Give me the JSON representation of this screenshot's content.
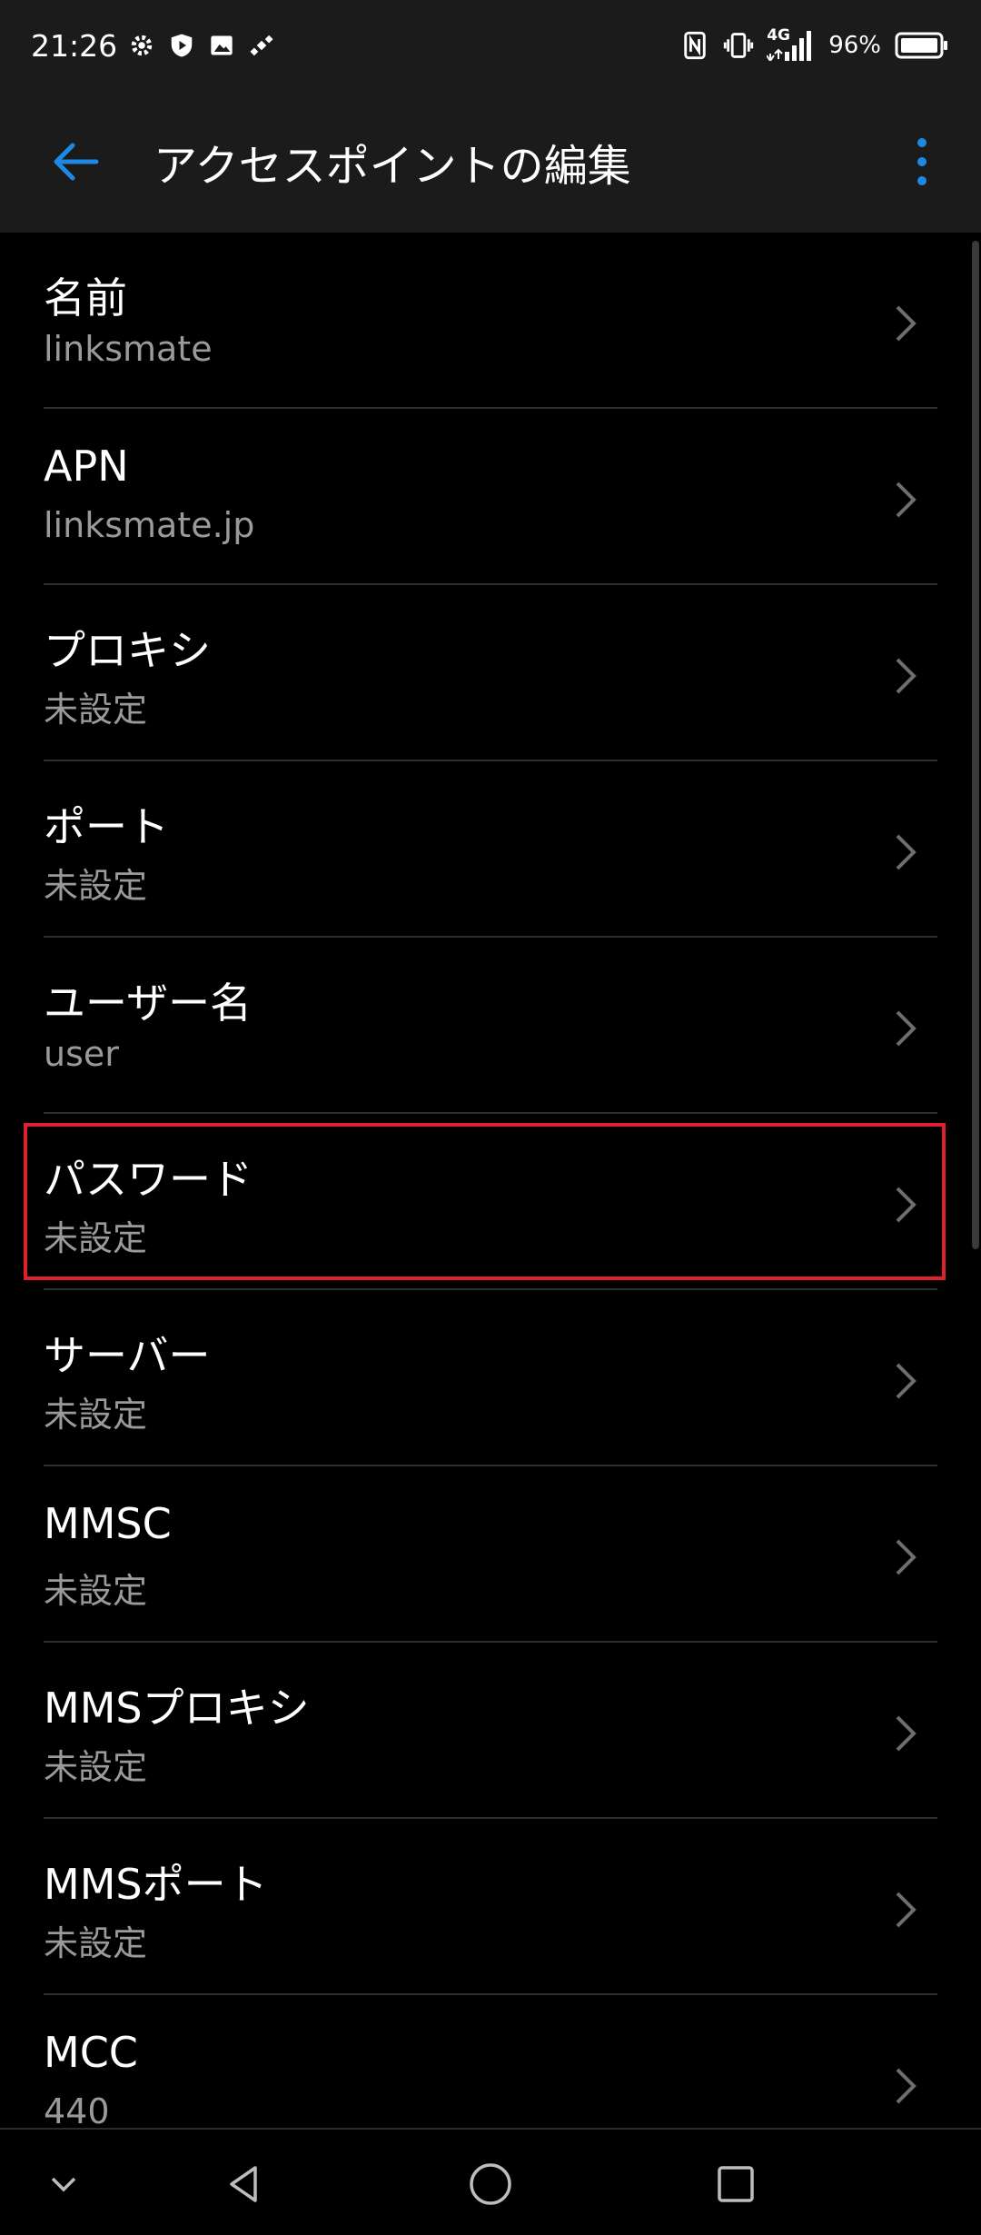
{
  "status_bar": {
    "time": "21:26",
    "left_icons": [
      "settings-icon",
      "shield-icon",
      "image-icon",
      "satellite-icon"
    ],
    "network": "4G",
    "battery": "96%"
  },
  "toolbar": {
    "title": "アクセスポイントの編集",
    "accent": "#1e88e5"
  },
  "settings": [
    {
      "title": "名前",
      "value": "linksmate"
    },
    {
      "title": "APN",
      "value": "linksmate.jp"
    },
    {
      "title": "プロキシ",
      "value": "未設定"
    },
    {
      "title": "ポート",
      "value": "未設定"
    },
    {
      "title": "ユーザー名",
      "value": "user"
    },
    {
      "title": "パスワード",
      "value": "未設定"
    },
    {
      "title": "サーバー",
      "value": "未設定"
    },
    {
      "title": "MMSC",
      "value": "未設定"
    },
    {
      "title": "MMSプロキシ",
      "value": "未設定"
    },
    {
      "title": "MMSポート",
      "value": "未設定"
    },
    {
      "title": "MCC",
      "value": "440"
    }
  ],
  "highlight_color": "#e0202f"
}
